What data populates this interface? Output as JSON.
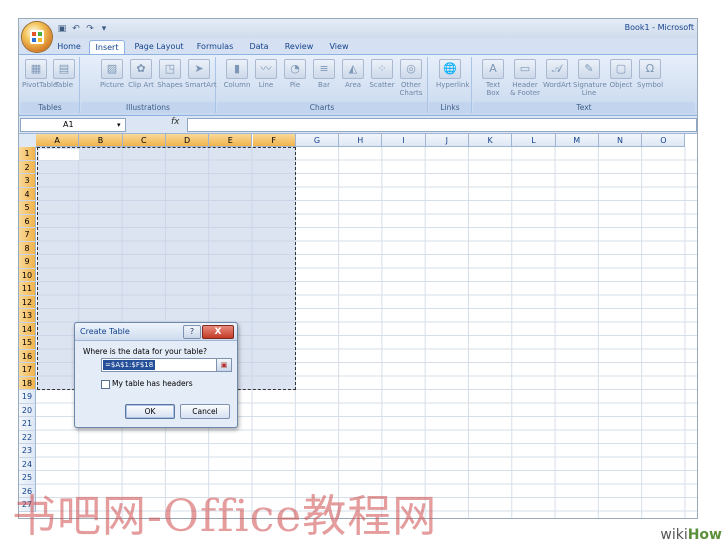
{
  "window": {
    "title": "Book1 - Microsoft"
  },
  "ribbon_tabs": [
    {
      "label": "Home",
      "active": false
    },
    {
      "label": "Insert",
      "active": true
    },
    {
      "label": "Page Layout",
      "active": false
    },
    {
      "label": "Formulas",
      "active": false
    },
    {
      "label": "Data",
      "active": false
    },
    {
      "label": "Review",
      "active": false
    },
    {
      "label": "View",
      "active": false
    }
  ],
  "groups": {
    "tables": {
      "label": "Tables",
      "buttons": [
        "PivotTable",
        "Table"
      ]
    },
    "illustrations": {
      "label": "Illustrations",
      "buttons": [
        "Picture",
        "Clip Art",
        "Shapes",
        "SmartArt"
      ]
    },
    "charts": {
      "label": "Charts",
      "buttons": [
        "Column",
        "Line",
        "Pie",
        "Bar",
        "Area",
        "Scatter",
        "Other Charts"
      ]
    },
    "links": {
      "label": "Links",
      "buttons": [
        "Hyperlink"
      ]
    },
    "text": {
      "label": "Text",
      "buttons": [
        "Text Box",
        "Header & Footer",
        "WordArt",
        "Signature Line",
        "Object",
        "Symbol"
      ]
    }
  },
  "formula_bar": {
    "name_box": "A1",
    "fx": "fx",
    "value": ""
  },
  "columns": [
    "A",
    "B",
    "C",
    "D",
    "E",
    "F",
    "G",
    "H",
    "I",
    "J",
    "K",
    "L",
    "M",
    "N",
    "O"
  ],
  "rows": [
    "1",
    "2",
    "3",
    "4",
    "5",
    "6",
    "7",
    "8",
    "9",
    "10",
    "11",
    "12",
    "13",
    "14",
    "15",
    "16",
    "17",
    "18",
    "19",
    "20",
    "21",
    "22",
    "23",
    "24",
    "25",
    "26",
    "27"
  ],
  "selected_columns": [
    "A",
    "B",
    "C",
    "D",
    "E",
    "F"
  ],
  "selected_rows_count": 18,
  "dialog": {
    "title": "Create Table",
    "help": "?",
    "close": "X",
    "question": "Where is the data for your table?",
    "range": "=$A$1:$F$18",
    "checkbox_label": "My table has headers",
    "checkbox_checked": false,
    "ok": "OK",
    "cancel": "Cancel"
  },
  "watermark": "书吧网-Office教程网",
  "brand": {
    "wiki": "wiki",
    "how": "How"
  }
}
